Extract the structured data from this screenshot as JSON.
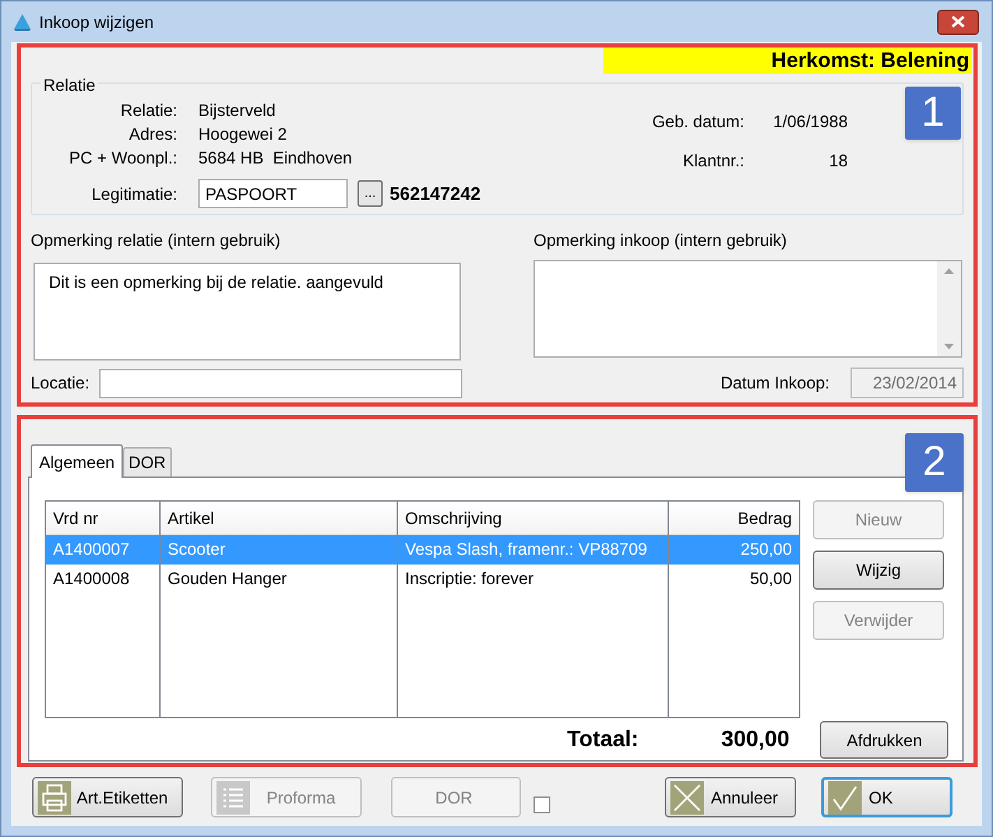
{
  "window": {
    "title": "Inkoop wijzigen"
  },
  "origin_banner": "Herkomst: Belening",
  "callouts": [
    "1",
    "2"
  ],
  "relatie": {
    "group_title": "Relatie",
    "fields": [
      {
        "label": "Relatie:",
        "value": "Bijsterveld"
      },
      {
        "label": "Adres:",
        "value": "Hoogewei 2"
      },
      {
        "label": "PC + Woonpl.:",
        "value": "5684 HB  Eindhoven"
      }
    ],
    "right_fields": [
      {
        "label": "Geb. datum:",
        "value": "1/06/1988"
      },
      {
        "label": "Klantnr.:",
        "value": "18"
      }
    ],
    "legitimatie": {
      "label": "Legitimatie:",
      "value": "PASPOORT",
      "browse": "...",
      "number": "562147242"
    }
  },
  "remarks": [
    {
      "label": "Opmerking relatie (intern gebruik)",
      "value": "Dit is een opmerking bij de relatie. aangevuld",
      "scrollbar": false
    },
    {
      "label": "Opmerking inkoop (intern gebruik)",
      "scrollbar": true
    }
  ],
  "locatie": {
    "label": "Locatie:"
  },
  "datum_inkoop": {
    "label": "Datum Inkoop:",
    "value": "23/02/2014",
    "disabled": true
  },
  "tabs": [
    {
      "label": "Algemeen",
      "selected": true
    },
    {
      "label": "DOR",
      "selected": false
    }
  ],
  "table": {
    "columns": [
      {
        "label": "Vrd nr",
        "kind": "text"
      },
      {
        "label": "Artikel",
        "kind": "text"
      },
      {
        "label": "Omschrijving",
        "kind": "text"
      },
      {
        "label": "Bedrag",
        "kind": "amount"
      }
    ],
    "rows": [
      {
        "cells": [
          "A1400007",
          "Scooter",
          "Vespa Slash, framenr.: VP88709",
          "250,00"
        ],
        "selected": true
      },
      {
        "cells": [
          "A1400008",
          "Gouden Hanger",
          "Inscriptie: forever",
          "50,00"
        ],
        "selected": false
      }
    ]
  },
  "side_buttons": [
    {
      "label": "Nieuw",
      "disabled": true
    },
    {
      "label": "Wijzig",
      "disabled": false
    },
    {
      "label": "Verwijder",
      "disabled": true
    }
  ],
  "total": {
    "label": "Totaal:",
    "value": "300,00"
  },
  "print_button": {
    "label": "Afdrukken"
  },
  "footer_left": [
    {
      "label": "Art.Etiketten",
      "kind": "printer",
      "disabled": false
    },
    {
      "label": "Proforma",
      "kind": "list",
      "disabled": true
    },
    {
      "label": "DOR",
      "kind": "plain",
      "disabled": true
    }
  ],
  "footer_checkbox": {
    "checked": false
  },
  "footer_right": [
    {
      "label": "Annuleer",
      "kind": "cross",
      "default": false
    },
    {
      "label": "OK",
      "kind": "check",
      "default": true
    }
  ]
}
